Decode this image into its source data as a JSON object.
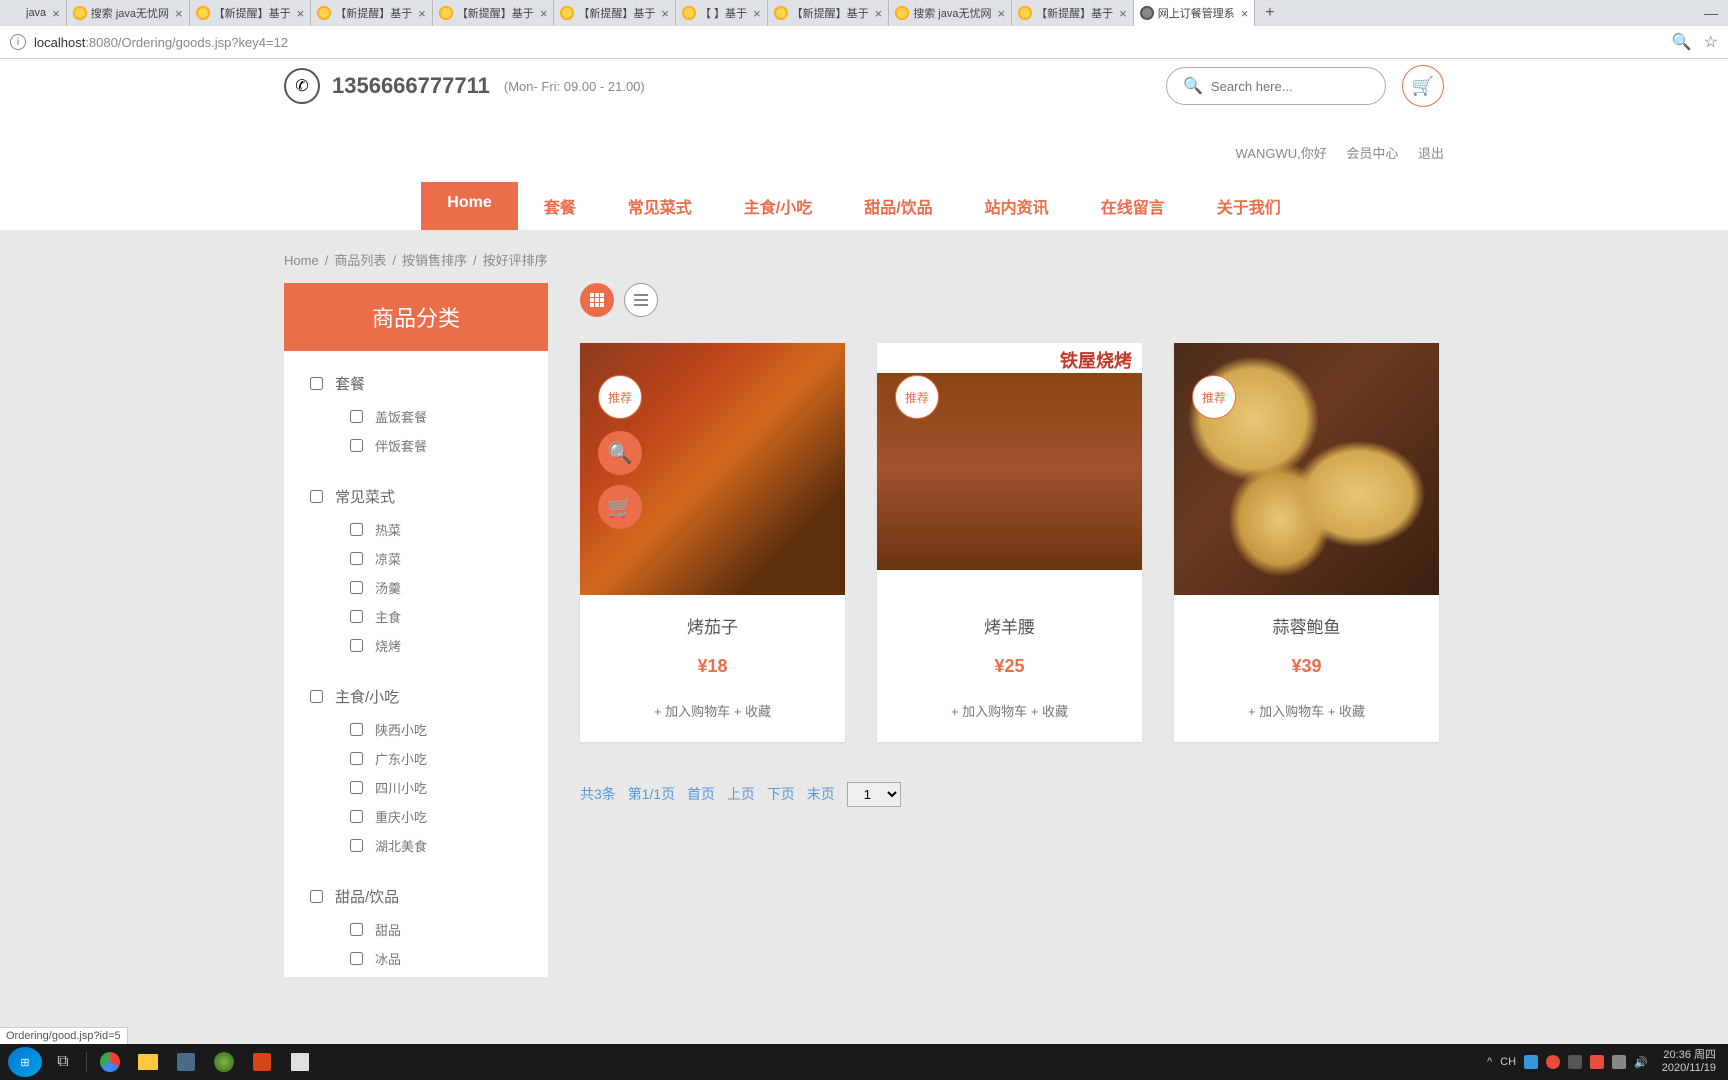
{
  "tabs": [
    {
      "title": "java",
      "fav": "none"
    },
    {
      "title": "搜索 java无忧网",
      "fav": "y"
    },
    {
      "title": "【新提醒】基于",
      "fav": "y"
    },
    {
      "title": "【新提醒】基于",
      "fav": "y"
    },
    {
      "title": "【新提醒】基于",
      "fav": "y"
    },
    {
      "title": "【新提醒】基于",
      "fav": "y"
    },
    {
      "title": "【       】基于",
      "fav": "y"
    },
    {
      "title": "【新提醒】基于",
      "fav": "y"
    },
    {
      "title": "搜索 java无忧网",
      "fav": "y"
    },
    {
      "title": "【新提醒】基于",
      "fav": "y"
    },
    {
      "title": "网上订餐管理系",
      "fav": "g",
      "active": true
    }
  ],
  "url": {
    "host": "localhost",
    "port": ":8080",
    "path": "/Ordering/goods.jsp?key4=12"
  },
  "status_url": "Ordering/good.jsp?id=5",
  "header": {
    "phone": "1356666777711",
    "hours": "(Mon- Fri: 09.00 - 21.00)",
    "search_placeholder": "Search here..."
  },
  "userbar": {
    "greeting": "WANGWU,你好",
    "member": "会员中心",
    "logout": "退出"
  },
  "nav": [
    {
      "label": "Home",
      "active": true
    },
    {
      "label": "套餐"
    },
    {
      "label": "常见菜式"
    },
    {
      "label": "主食/小吃"
    },
    {
      "label": "甜品/饮品"
    },
    {
      "label": "站内资讯"
    },
    {
      "label": "在线留言"
    },
    {
      "label": "关于我们"
    }
  ],
  "breadcrumb": [
    "Home",
    "商品列表",
    "按销售排序",
    "按好评排序"
  ],
  "sidebar": {
    "title": "商品分类",
    "groups": [
      {
        "parent": "套餐",
        "children": [
          "盖饭套餐",
          "伴饭套餐"
        ]
      },
      {
        "parent": "常见菜式",
        "children": [
          "热菜",
          "凉菜",
          "汤羹",
          "主食",
          "烧烤"
        ]
      },
      {
        "parent": "主食/小吃",
        "children": [
          "陕西小吃",
          "广东小吃",
          "四川小吃",
          "重庆小吃",
          "湖北美食"
        ]
      },
      {
        "parent": "甜品/饮品",
        "children": [
          "甜品",
          "冰品"
        ]
      }
    ]
  },
  "products": [
    {
      "name": "烤茄子",
      "price": "¥18",
      "badge": "推荐",
      "add": "+ 加入购物车",
      "fav": "+ 收藏",
      "hover": true
    },
    {
      "name": "烤羊腰",
      "price": "¥25",
      "badge": "推荐",
      "add": "+ 加入购物车",
      "fav": "+ 收藏"
    },
    {
      "name": "蒜蓉鲍鱼",
      "price": "¥39",
      "badge": "推荐",
      "add": "+ 加入购物车",
      "fav": "+ 收藏"
    }
  ],
  "pagination": {
    "total": "共3条",
    "page": "第1/1页",
    "first": "首页",
    "prev": "上页",
    "next": "下页",
    "last": "末页",
    "select": "1"
  },
  "taskbar": {
    "ime": "CH",
    "time": "20:36 周四",
    "date": "2020/11/19"
  }
}
